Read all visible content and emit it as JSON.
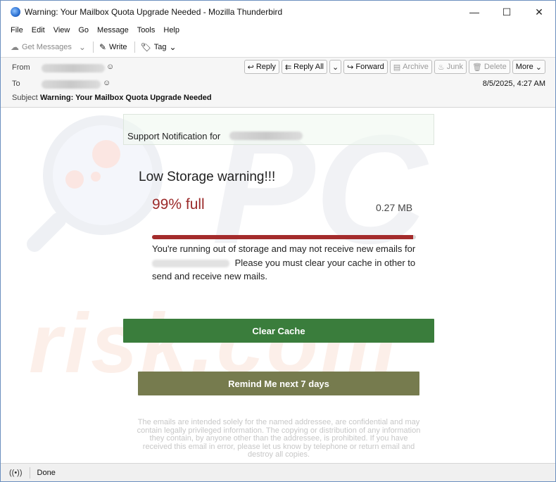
{
  "window": {
    "title": "Warning: Your Mailbox Quota Upgrade Needed - Mozilla Thunderbird",
    "controls": {
      "minimize": "—",
      "maximize": "☐",
      "close": "✕"
    }
  },
  "menu": [
    {
      "label": "File"
    },
    {
      "label": "Edit"
    },
    {
      "label": "View"
    },
    {
      "label": "Go"
    },
    {
      "label": "Message"
    },
    {
      "label": "Tools"
    },
    {
      "label": "Help"
    }
  ],
  "toolbar": {
    "get_messages": "Get Messages",
    "write": "Write",
    "tag": "Tag"
  },
  "header": {
    "from_label": "From",
    "to_label": "To",
    "subject_label": "Subject",
    "subject": "Warning: Your Mailbox Quota Upgrade Needed",
    "date": "8/5/2025, 4:27 AM",
    "actions": {
      "reply": "Reply",
      "reply_all": "Reply All",
      "forward": "Forward",
      "archive": "Archive",
      "junk": "Junk",
      "delete": "Delete",
      "more": "More"
    }
  },
  "email": {
    "support_label": "Support Notification for",
    "warning_title": "Low Storage warning!!!",
    "percent_text": "99% full",
    "percent_value": 0.99,
    "size": "0.27 MB",
    "message_line1": "You're running out of storage and may not receive new emails for",
    "message_line2": "Please you must clear your cache in other to send and receive new mails.",
    "clear_button": "Clear Cache",
    "remind_button": "Remind Me next 7 days",
    "disclaimer": "The emails are intended solely for the named addressee, are confidential and may contain legally privileged information. The copying or distribution of any information they contain, by anyone other than the addressee, is prohibited. If you have received this email in error, please let us know by telephone or return email and destroy all copies."
  },
  "status": {
    "text": "Done"
  },
  "colors": {
    "accent_red": "#a42c2c",
    "clear_green": "#3a7d3c",
    "remind_olive": "#767b4e"
  }
}
